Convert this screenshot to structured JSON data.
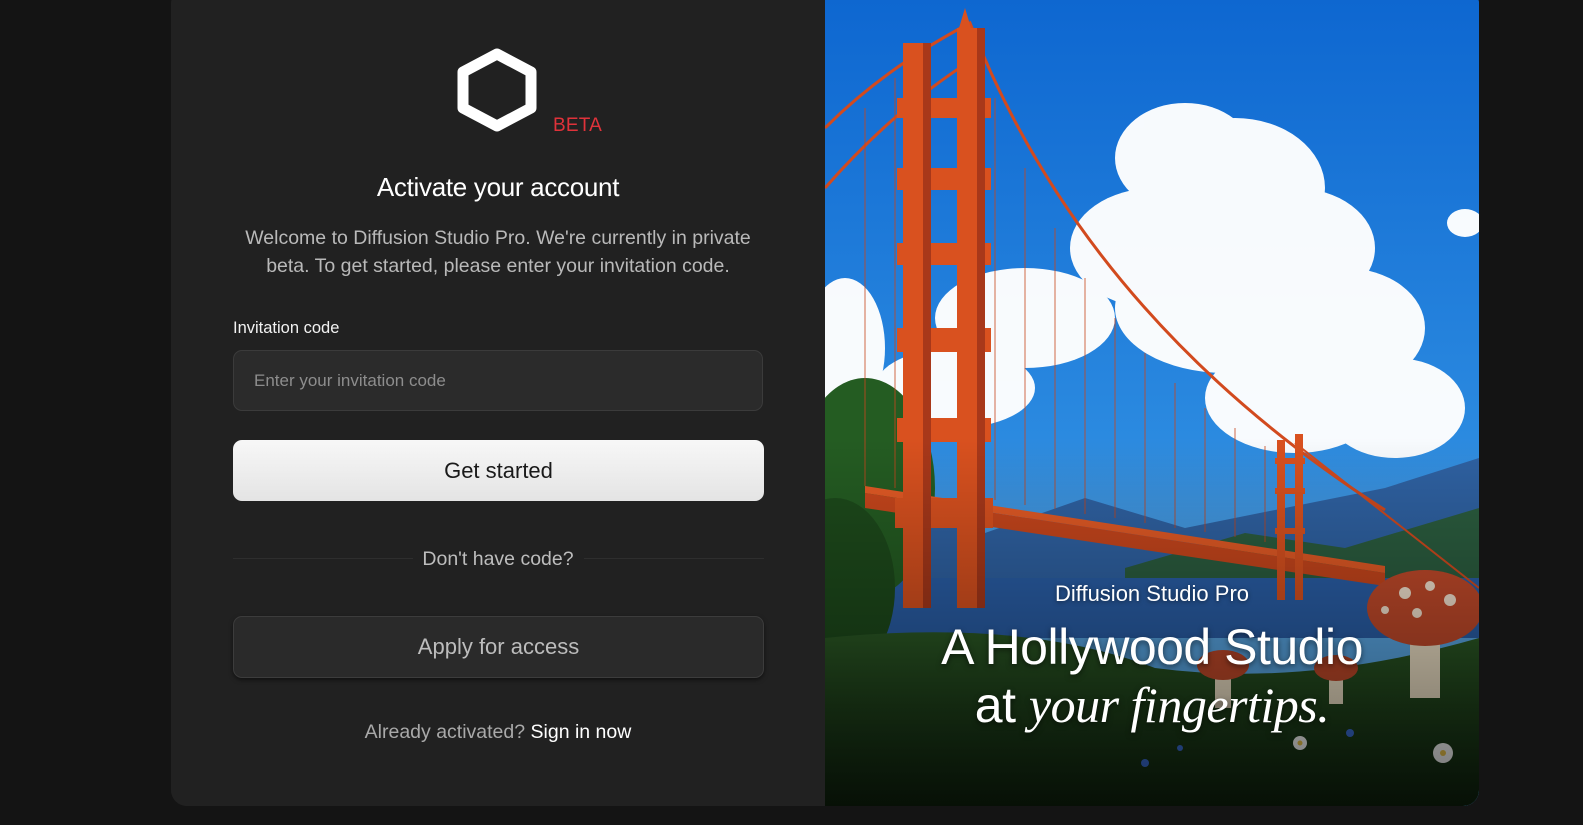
{
  "brand": {
    "badge": "BETA"
  },
  "form": {
    "title": "Activate your account",
    "intro": "Welcome to Diffusion Studio Pro. We're currently in private beta. To get started, please enter your invitation code.",
    "field_label": "Invitation code",
    "input_placeholder": "Enter your invitation code",
    "input_value": "",
    "submit_label": "Get started",
    "divider_text": "Don't have code?",
    "apply_label": "Apply for access",
    "signin_prompt": "Already activated?",
    "signin_link": "Sign in now"
  },
  "hero": {
    "brand_name": "Diffusion Studio Pro",
    "headline_line1": "A Hollywood Studio",
    "headline_line2_plain": "at",
    "headline_line2_italic": "your fingertips."
  },
  "colors": {
    "badge": "#e0323a",
    "background": "#141414",
    "card": "#212121"
  },
  "icons": [
    "hexagon-logo-icon"
  ]
}
